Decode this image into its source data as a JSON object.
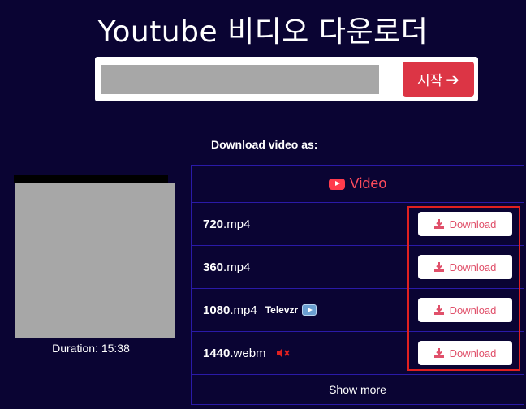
{
  "header": {
    "title": "Youtube 비디오 다운로더"
  },
  "search": {
    "start_label": "시작"
  },
  "download_heading": "Download video as:",
  "video": {
    "duration": "Duration: 15:38"
  },
  "panel": {
    "tab_label": "Video",
    "rows": [
      {
        "resolution": "720",
        "ext": ".mp4",
        "button": "Download"
      },
      {
        "resolution": "360",
        "ext": ".mp4",
        "button": "Download"
      },
      {
        "resolution": "1080",
        "ext": ".mp4",
        "extra": "Televzr",
        "button": "Download"
      },
      {
        "resolution": "1440",
        "ext": ".webm",
        "button": "Download",
        "muted": true
      }
    ],
    "show_more": "Show more"
  },
  "colors": {
    "background": "#0a0433",
    "accent_red": "#dc3545",
    "download_text": "#e0506a",
    "border": "#2a1aa8",
    "highlight": "#e02020"
  },
  "icons": [
    "youtube-icon",
    "arrow-right-icon",
    "download-icon",
    "televzr-icon",
    "mute-icon"
  ]
}
